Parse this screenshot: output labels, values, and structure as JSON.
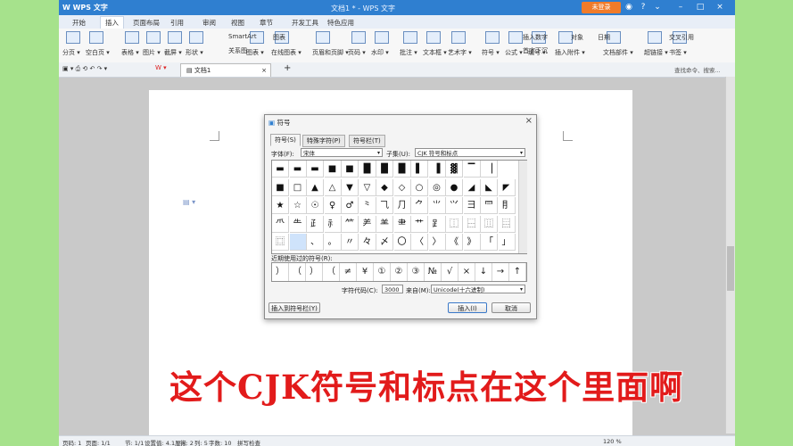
{
  "app": {
    "logo": "W WPS 文字",
    "doc_title": "文档1 * - WPS 文字",
    "login": "未登录"
  },
  "menus": [
    "开始",
    "插入",
    "页面布局",
    "引用",
    "审阅",
    "视图",
    "章节",
    "开发工具",
    "特色应用"
  ],
  "active_menu": "插入",
  "ribbon": {
    "big": [
      "分页",
      "空白页",
      "表格",
      "图片",
      "截屏",
      "形状",
      "图表",
      "在线图表",
      "页眉和页脚",
      "页码",
      "水印",
      "批注",
      "文本框",
      "艺术字",
      "符号",
      "公式",
      "编号",
      "插入附件",
      "文档部件",
      "超链接",
      "书签"
    ],
    "small": [
      "SmartArt",
      "图表",
      "关系图",
      "首字下沉",
      "插入数字",
      "对象",
      "日期",
      "交叉引用"
    ]
  },
  "tabs": {
    "doc": "文档1"
  },
  "search_placeholder": "查找命令、搜索...",
  "dialog": {
    "title": "符号",
    "tabs": [
      "符号(S)",
      "特殊字符(P)",
      "符号栏(T)"
    ],
    "font_label": "字体(F):",
    "font_value": "宋体",
    "subset_label": "子集(U):",
    "subset_value": "CJK 符号和标点",
    "grid": [
      [
        "▬",
        "▬",
        "▬",
        "■",
        "■",
        "█",
        "█",
        "█",
        "▌",
        "▐",
        "▓",
        "▔",
        "▕"
      ],
      [
        "■",
        "□",
        "▲",
        "△",
        "▼",
        "▽",
        "◆",
        "◇",
        "○",
        "◎",
        "●",
        "◢",
        "◣",
        "◤"
      ],
      [
        "★",
        "☆",
        "☉",
        "♀",
        "♂",
        "⺀",
        "⺄",
        "⺆",
        "⺈",
        "⺌",
        "⺍",
        "⺕",
        "⺜",
        "⺝"
      ],
      [
        "⺥",
        "⺧",
        "⺪",
        "⺬",
        "⺮",
        "⺶",
        "⺷",
        "⺻",
        "⺾",
        "⻊",
        "⿰",
        "⿱",
        "⿲",
        "⿳"
      ],
      [
        "⿴",
        "",
        "、",
        "。",
        "〃",
        "々",
        "〆",
        "〇",
        "〈",
        "〉",
        "《",
        "》",
        "「",
        "」"
      ]
    ],
    "recent_label": "近期使用过的符号(R):",
    "recent": [
      "）",
      "（",
      "）",
      "（",
      "≠",
      "¥",
      "①",
      "②",
      "③",
      "№",
      "√",
      "×",
      "↓",
      "→",
      "↑"
    ],
    "code_label": "字符代码(C):",
    "code_value": "3000",
    "from_label": "来自(M):",
    "from_value": "Unicode(十六进制)",
    "btn_to_bar": "插入到符号栏(Y)",
    "btn_insert": "插入(I)",
    "btn_cancel": "取消"
  },
  "doc_text": "XX",
  "caption": "这个CJK符号和标点在这个里面啊",
  "status": [
    "页码: 1",
    "页面: 1/1",
    "节: 1/1",
    "设置值: 4.1厘米",
    "行: 2",
    "列: 5",
    "字数: 10",
    "拼写检查",
    "120 %"
  ]
}
